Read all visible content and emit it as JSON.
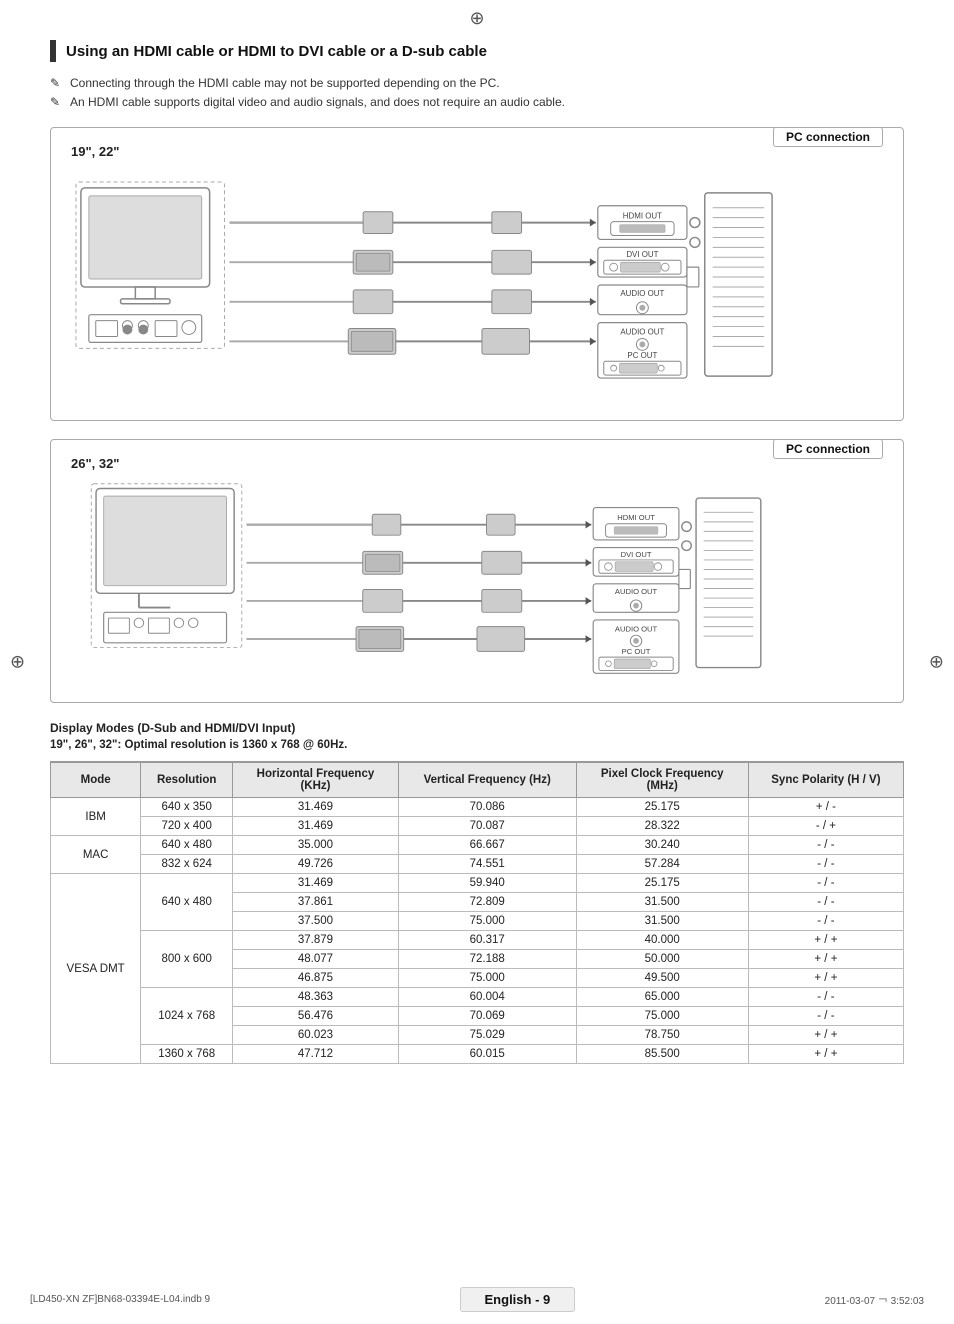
{
  "page": {
    "top_compass": "⊕",
    "left_compass": "⊕",
    "right_compass": "⊕"
  },
  "section": {
    "title": "Using an HDMI cable or HDMI to DVI cable or a D-sub cable"
  },
  "notes": [
    "Connecting through the HDMI cable may not be supported depending on the PC.",
    "An HDMI cable supports digital video and audio signals, and does not require an audio cable."
  ],
  "diagram1": {
    "pc_connection": "PC connection",
    "monitor_label": "19\", 22\""
  },
  "diagram2": {
    "pc_connection": "PC connection",
    "monitor_label": "26\", 32\""
  },
  "display_modes": {
    "title": "Display Modes (D-Sub and HDMI/DVI Input)",
    "subtitle_bold": "19\", 26\", 32\"",
    "subtitle_rest": ": Optimal resolution is 1360 x 768 @ 60Hz.",
    "columns": [
      "Mode",
      "Resolution",
      "Horizontal Frequency\n(KHz)",
      "Vertical Frequency (Hz)",
      "Pixel Clock Frequency\n(MHz)",
      "Sync Polarity (H / V)"
    ],
    "rows": [
      {
        "mode": "IBM",
        "resolution": "640 x 350",
        "hfreq": "31.469",
        "vfreq": "70.086",
        "pixel": "25.175",
        "sync": "+ / -"
      },
      {
        "mode": "",
        "resolution": "720 x 400",
        "hfreq": "31.469",
        "vfreq": "70.087",
        "pixel": "28.322",
        "sync": "- / +"
      },
      {
        "mode": "MAC",
        "resolution": "640 x 480",
        "hfreq": "35.000",
        "vfreq": "66.667",
        "pixel": "30.240",
        "sync": "- / -"
      },
      {
        "mode": "",
        "resolution": "832 x 624",
        "hfreq": "49.726",
        "vfreq": "74.551",
        "pixel": "57.284",
        "sync": "- / -"
      },
      {
        "mode": "VESA DMT",
        "resolution": "640 x 480",
        "hfreq": "31.469",
        "vfreq": "59.940",
        "pixel": "25.175",
        "sync": "- / -"
      },
      {
        "mode": "",
        "resolution": "",
        "hfreq": "37.861",
        "vfreq": "72.809",
        "pixel": "31.500",
        "sync": "- / -"
      },
      {
        "mode": "",
        "resolution": "",
        "hfreq": "37.500",
        "vfreq": "75.000",
        "pixel": "31.500",
        "sync": "- / -"
      },
      {
        "mode": "",
        "resolution": "800 x 600",
        "hfreq": "37.879",
        "vfreq": "60.317",
        "pixel": "40.000",
        "sync": "+ / +"
      },
      {
        "mode": "",
        "resolution": "",
        "hfreq": "48.077",
        "vfreq": "72.188",
        "pixel": "50.000",
        "sync": "+ / +"
      },
      {
        "mode": "",
        "resolution": "",
        "hfreq": "46.875",
        "vfreq": "75.000",
        "pixel": "49.500",
        "sync": "+ / +"
      },
      {
        "mode": "",
        "resolution": "1024 x 768",
        "hfreq": "48.363",
        "vfreq": "60.004",
        "pixel": "65.000",
        "sync": "- / -"
      },
      {
        "mode": "",
        "resolution": "",
        "hfreq": "56.476",
        "vfreq": "70.069",
        "pixel": "75.000",
        "sync": "- / -"
      },
      {
        "mode": "",
        "resolution": "",
        "hfreq": "60.023",
        "vfreq": "75.029",
        "pixel": "78.750",
        "sync": "+ / +"
      },
      {
        "mode": "",
        "resolution": "1360 x 768",
        "hfreq": "47.712",
        "vfreq": "60.015",
        "pixel": "85.500",
        "sync": "+ / +"
      }
    ]
  },
  "footer": {
    "left": "[LD450-XN ZF]BN68-03394E-L04.indb   9",
    "center": "English - 9",
    "right": "2011-03-07   ￢ 3:52:03"
  }
}
